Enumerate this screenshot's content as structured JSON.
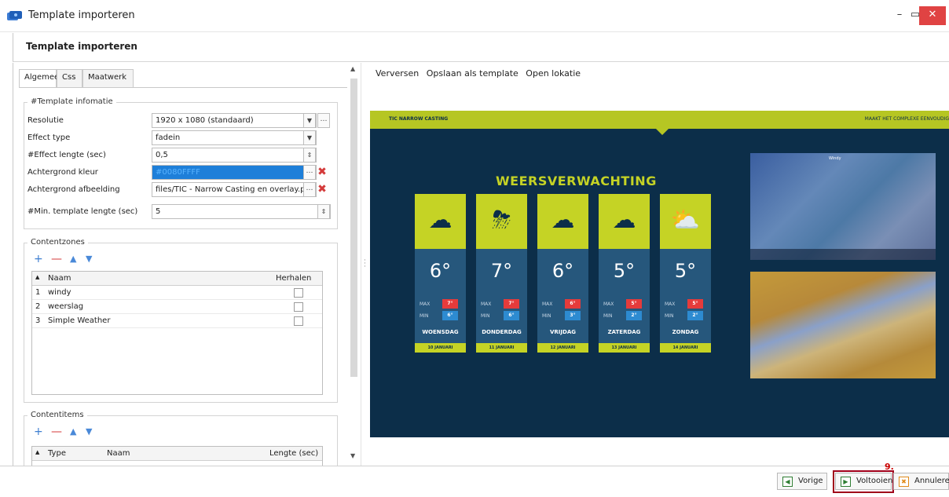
{
  "window": {
    "title": "Template importeren",
    "min": "–",
    "max": "▭",
    "close": "✕"
  },
  "subheader": {
    "title": "Template importeren"
  },
  "tabs": [
    "Algemeen",
    "Css",
    "Maatwerk"
  ],
  "template_info": {
    "group_title": "#Template infomatie",
    "rows": [
      {
        "label": "Resolutie",
        "value": "1920 x 1080 (standaard)"
      },
      {
        "label": "Effect type",
        "value": "fadein"
      },
      {
        "label": "#Effect lengte (sec)",
        "value": "0,5"
      },
      {
        "label": "Achtergrond kleur",
        "value": "#0080FFFF"
      },
      {
        "label": "Achtergrond afbeelding",
        "value": "files/TIC - Narrow Casting en overlay.png"
      },
      {
        "label": "#Min. template lengte (sec)",
        "value": "5"
      }
    ]
  },
  "contentzones": {
    "group_title": "Contentzones",
    "col_name": "Naam",
    "col_repeat": "Herhalen",
    "rows": [
      {
        "n": "1",
        "name": "windy"
      },
      {
        "n": "2",
        "name": "weerslag"
      },
      {
        "n": "3",
        "name": "Simple Weather"
      }
    ]
  },
  "contentitems": {
    "group_title": "Contentitems",
    "col_type": "Type",
    "col_name": "Naam",
    "col_length": "Lengte (sec)"
  },
  "right_menu": [
    "Verversen",
    "Opslaan als template",
    "Open lokatie"
  ],
  "preview": {
    "top_left": "TIC NARROW CASTING",
    "top_right": "MAAKT HET COMPLEXE EENVOUDIG",
    "heading": "WEERSVERWACHTING",
    "max_label": "MAX",
    "min_label": "MIN",
    "cards": [
      {
        "icon": "☁",
        "temp": "6°",
        "max": "7°",
        "min": "6°",
        "day": "WOENSDAG",
        "date": "10 JANUARI"
      },
      {
        "icon": "⛈",
        "temp": "7°",
        "max": "7°",
        "min": "6°",
        "day": "DONDERDAG",
        "date": "11 JANUARI"
      },
      {
        "icon": "☁",
        "temp": "6°",
        "max": "6°",
        "min": "3°",
        "day": "VRIJDAG",
        "date": "12 JANUARI"
      },
      {
        "icon": "☁",
        "temp": "5°",
        "max": "5°",
        "min": "2°",
        "day": "ZATERDAG",
        "date": "13 JANUARI"
      },
      {
        "icon": "⛅",
        "temp": "5°",
        "max": "5°",
        "min": "2°",
        "day": "ZONDAG",
        "date": "14 JANUARI"
      }
    ],
    "map_label": "Windy"
  },
  "footer": {
    "prev": "Vorige",
    "done": "Voltooien",
    "cancel": "Annuleren",
    "step": "9."
  }
}
